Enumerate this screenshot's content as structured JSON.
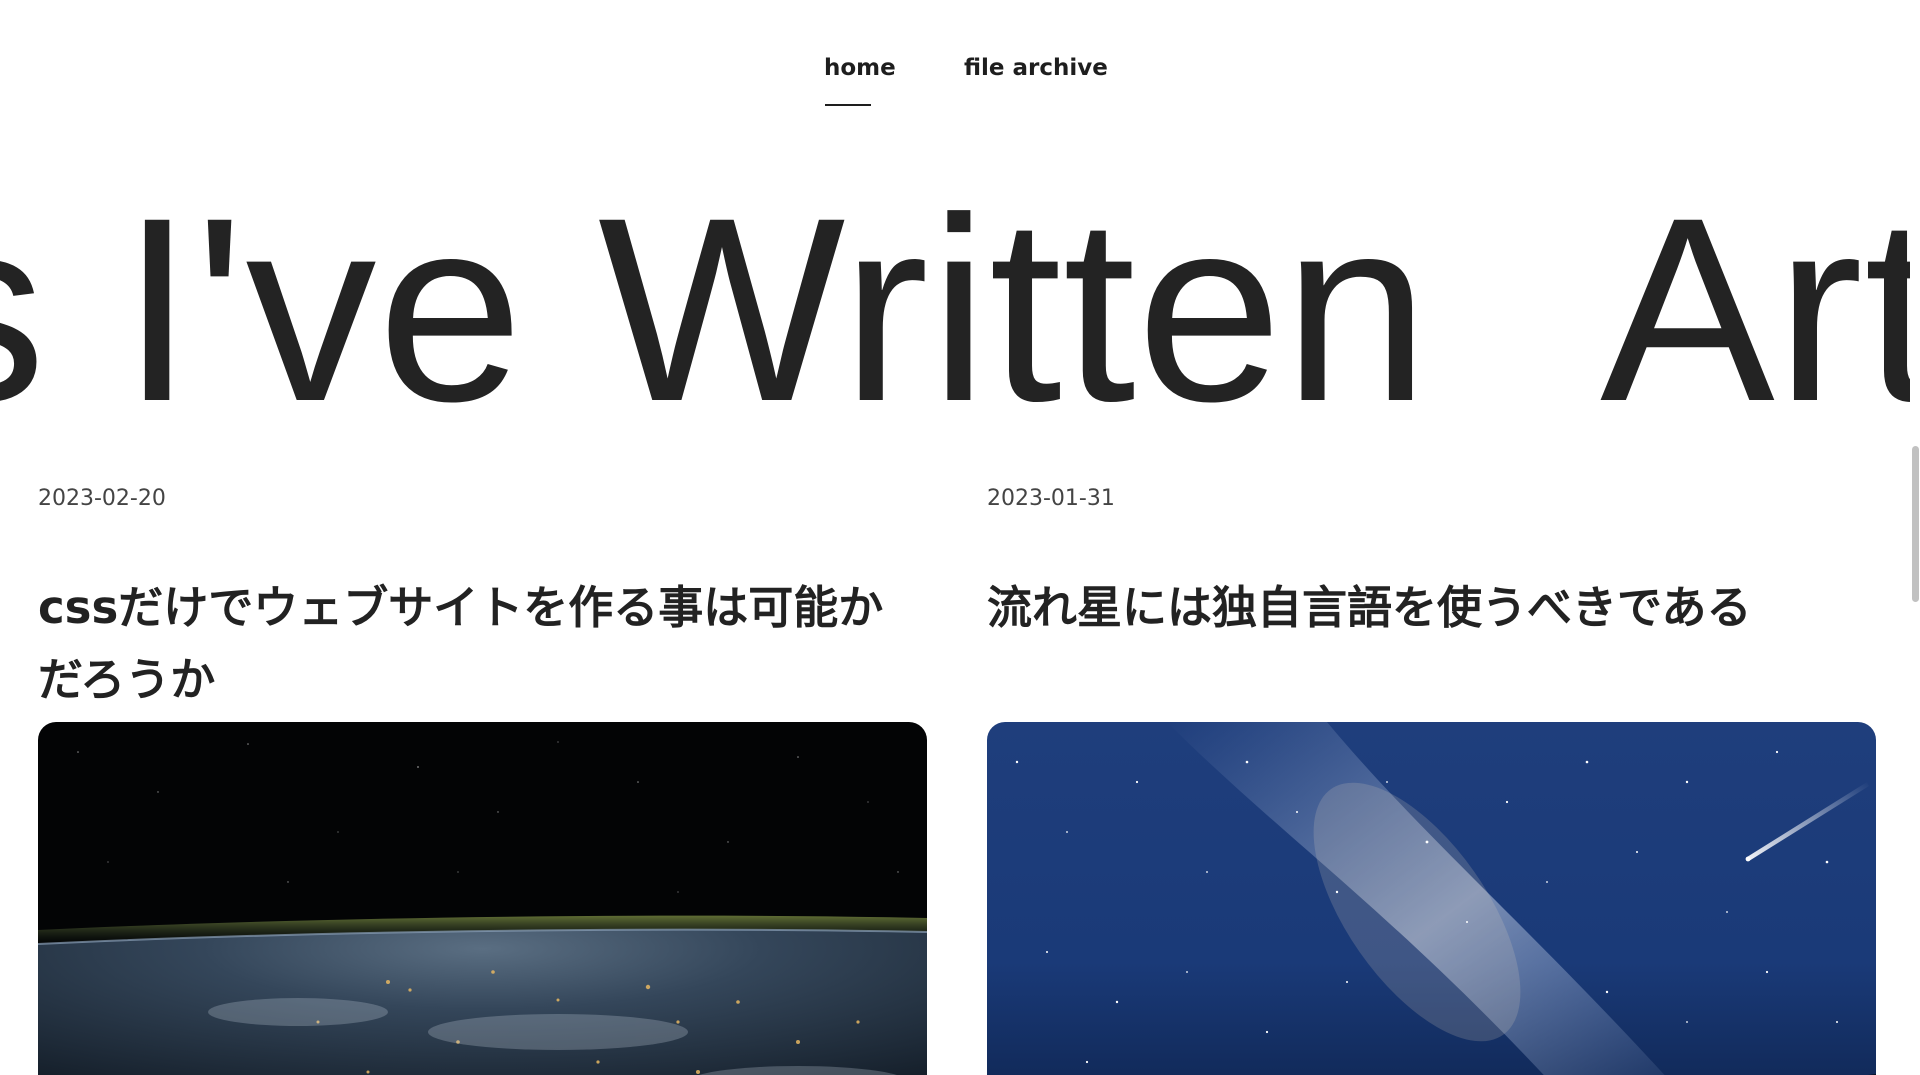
{
  "nav": {
    "items": [
      {
        "label": "home",
        "active": true
      },
      {
        "label": "file archive",
        "active": false
      }
    ]
  },
  "marquee": {
    "text": "Articles I've Written"
  },
  "articles": [
    {
      "date": "2023-02-20",
      "title": "cssだけでウェブサイトを作る事は可能かだろうか",
      "image": "earth-from-space-at-night"
    },
    {
      "date": "2023-01-31",
      "title": "流れ星には独自言語を使うべきである",
      "image": "milky-way-with-shooting-star"
    }
  ],
  "colors": {
    "text": "#222222",
    "background": "#ffffff",
    "date": "#444444"
  }
}
